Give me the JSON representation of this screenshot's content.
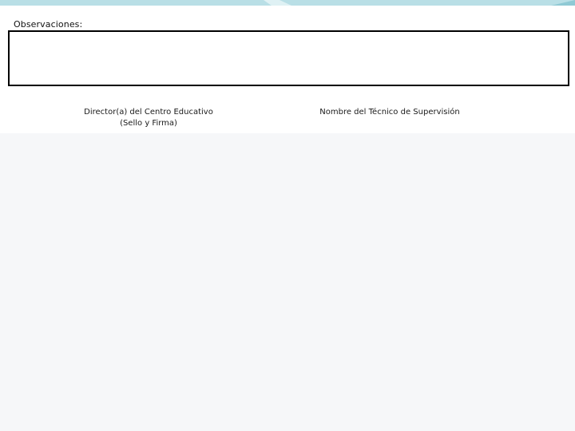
{
  "form": {
    "observations_label": "Observaciones:",
    "observations_value": ""
  },
  "signatures": {
    "director_line1": "Director(a) del Centro Educativo",
    "director_line2": "(Sello y Firma)",
    "technician": "Nombre del Técnico de Supervisión"
  },
  "colors": {
    "accent_band": "#b9dfe6",
    "accent_band_light": "#dff1f4",
    "page_background": "#f6f7f9",
    "box_border": "#000000"
  }
}
